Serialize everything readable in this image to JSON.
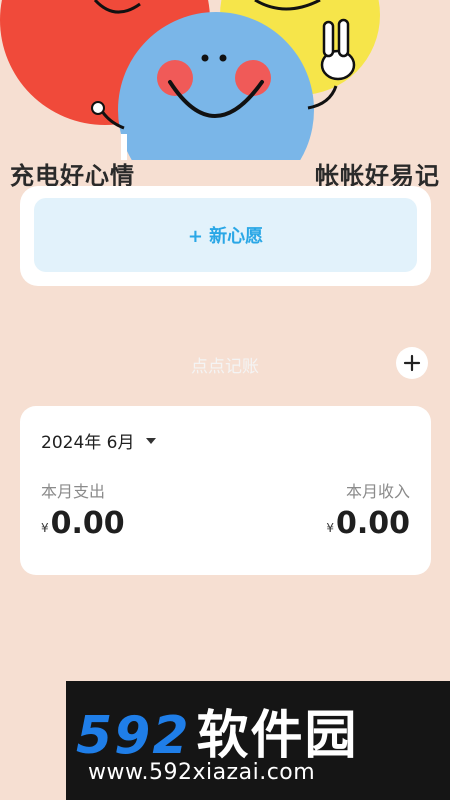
{
  "hero": {
    "slogan_left": "充电好心情",
    "slogan_right": "帐帐好易记"
  },
  "wishes": {
    "new_wish_label": "+ 新心愿"
  },
  "records": {
    "section_title": "点点记账",
    "add_icon": "plus-icon"
  },
  "summary": {
    "month": "2024年 6月",
    "expense_label": "本月支出",
    "income_label": "本月收入",
    "currency": "¥",
    "expense_value": "0.00",
    "income_value": "0.00"
  },
  "watermark": {
    "brand_number": "592",
    "brand_name": "软件园",
    "url": "www.592xiazai.com"
  },
  "colors": {
    "background": "#f6dfd2",
    "accent": "#2aa7e6",
    "wish_button_bg": "#e2f2fb"
  }
}
